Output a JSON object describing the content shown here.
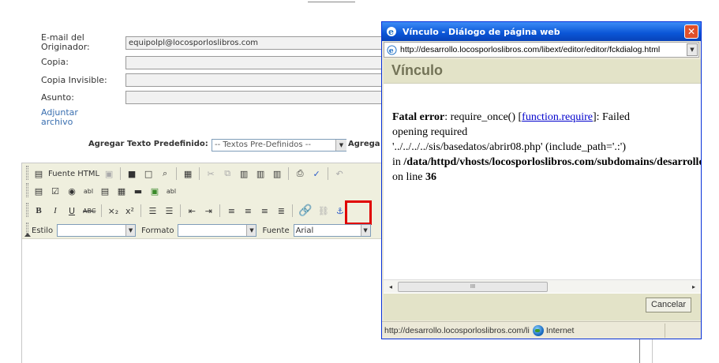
{
  "form": {
    "originator_label": "E-mail del Originador:",
    "originator_value": "equipolpl@locosporloslibros.com",
    "copy_label": "Copia:",
    "bcc_label": "Copia Invisible:",
    "subject_label": "Asunto:",
    "attach_label": "Adjuntar archivo",
    "predefined_label": "Agregar Texto Predefinido:",
    "predefined_value": "-- Textos Pre-Definidos --",
    "predefined_tail": "Agrega"
  },
  "editor": {
    "source_label": "Fuente HTML",
    "style_label": "Estilo",
    "format_label": "Formato",
    "font_label": "Fuente",
    "font_value": "Arial",
    "input_text_label": "abl"
  },
  "dialog": {
    "title": "Vínculo - Diálogo de página web",
    "url": "http://desarrollo.locosporloslibros.com/libext/editor/editor/fckdialog.html",
    "header": "Vínculo",
    "error": {
      "label": "Fatal error",
      "text1": ": require_once() [",
      "link": "function.require",
      "text2": "]: Failed",
      "line2": "opening required",
      "line3": "'../../../../sis/basedatos/abrir08.php' (include_path='.:')",
      "in_word": "in ",
      "path": "/data/httpd/vhosts/locosporloslibros.com/subdomains/desarrollo",
      "on_line": "on line ",
      "line_number": "36"
    },
    "scroll_thumb": "III",
    "cancel_label": "Cancelar",
    "status_url": "http://desarrollo.locosporloslibros.com/li",
    "status_zone": "Internet"
  },
  "colors": {
    "titlebar": "#0a55d6",
    "dialog_header_bg": "#e3e3c8",
    "highlight": "#e00000",
    "link": "#3a6fb0"
  }
}
